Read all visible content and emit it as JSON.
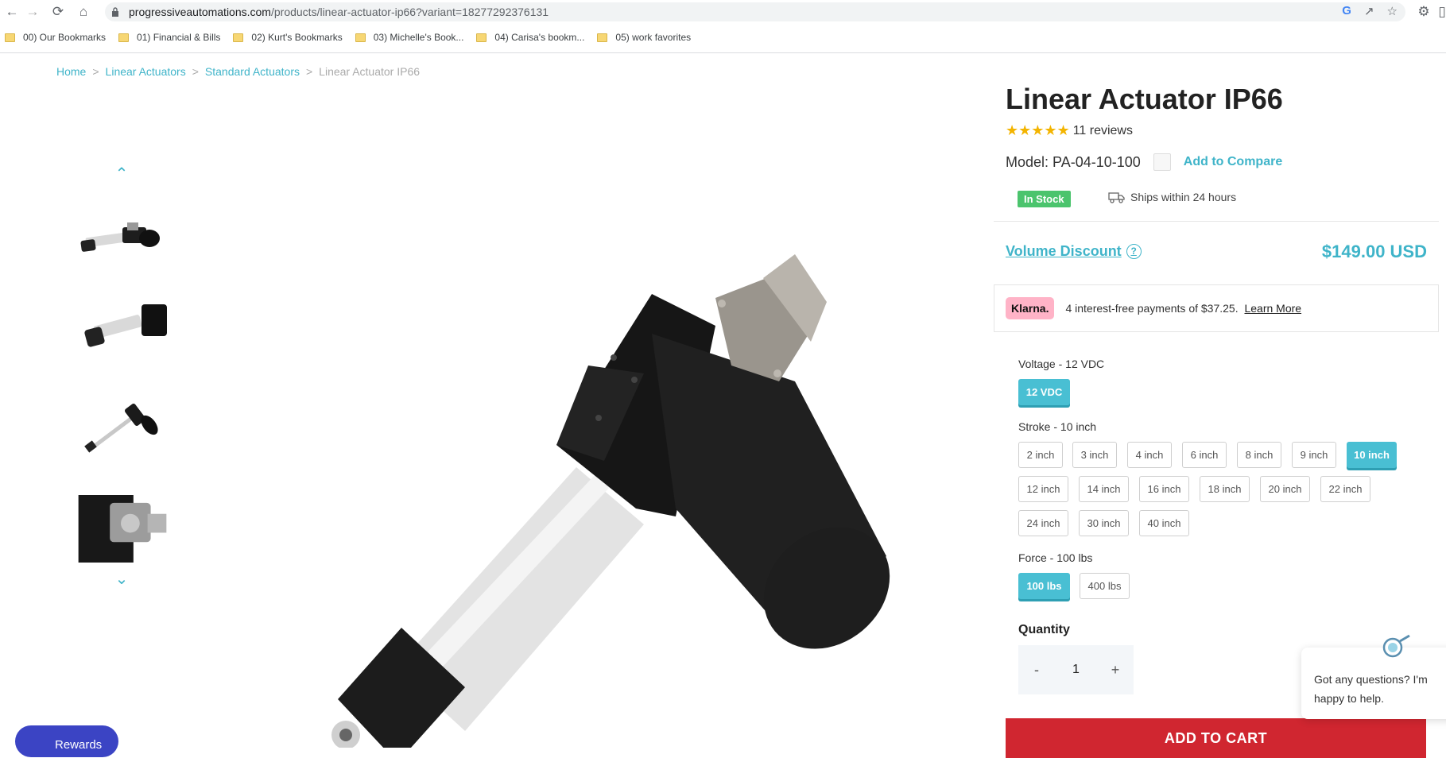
{
  "browser": {
    "url_host": "progressiveautomations.com",
    "url_path": "/products/linear-actuator-ip66?variant=18277292376131",
    "bookmarks": [
      "00) Our Bookmarks",
      "01) Financial & Bills",
      "02) Kurt's Bookmarks",
      "03) Michelle's Book...",
      "04) Carisa's bookm...",
      "05) work favorites"
    ]
  },
  "breadcrumb": {
    "items": [
      "Home",
      "Linear Actuators",
      "Standard Actuators"
    ],
    "separator": ">",
    "current": "Linear Actuator IP66"
  },
  "product": {
    "title": "Linear Actuator IP66",
    "stars": "★★★★★",
    "rating": 5,
    "reviews": "11 reviews",
    "model": "Model: PA-04-10-100",
    "compare": "Add to Compare",
    "stock": "In Stock",
    "shipping": "Ships within 24 hours",
    "volume_discount": "Volume Discount",
    "price": "$149.00 USD"
  },
  "klarna": {
    "logo": "Klarna.",
    "text": "4 interest-free payments of $37.25.",
    "learn_more": "Learn More"
  },
  "options": {
    "voltage": {
      "label": "Voltage - 12 VDC",
      "values": [
        "12 VDC"
      ],
      "selected": "12 VDC"
    },
    "stroke": {
      "label": "Stroke - 10 inch",
      "values": [
        "2 inch",
        "3 inch",
        "4 inch",
        "6 inch",
        "8 inch",
        "9 inch",
        "10 inch",
        "12 inch",
        "14 inch",
        "16 inch",
        "18 inch",
        "20 inch",
        "22 inch",
        "24 inch",
        "30 inch",
        "40 inch"
      ],
      "selected": "10 inch"
    },
    "force": {
      "label": "Force - 100 lbs",
      "values": [
        "100 lbs",
        "400 lbs"
      ],
      "selected": "100 lbs"
    }
  },
  "quantity": {
    "label": "Quantity",
    "value": "1",
    "minus": "-",
    "plus": "+"
  },
  "cart": {
    "button": "ADD TO CART"
  },
  "chat": {
    "message": "Got any questions? I'm happy to help."
  },
  "rewards": {
    "label": "Rewards"
  },
  "colors": {
    "accent": "#3fb4c9",
    "stock_green": "#4bc46d",
    "cart_red": "#d02630",
    "star": "#f3b400",
    "klarna_pink": "#ffb3c7"
  }
}
